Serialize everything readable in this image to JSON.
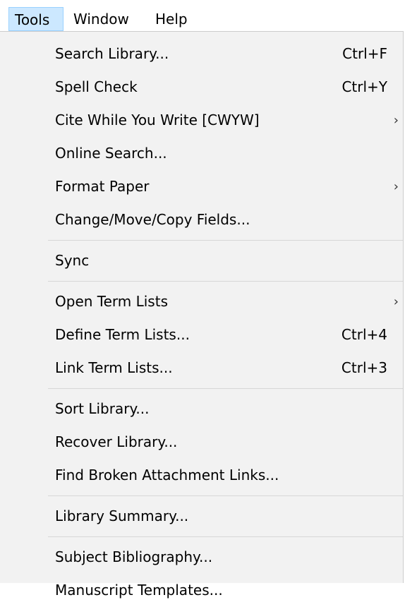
{
  "menubar": {
    "items": [
      {
        "label": "Tools",
        "active": true
      },
      {
        "label": "Window",
        "active": false
      },
      {
        "label": "Help",
        "active": false
      }
    ]
  },
  "menu": {
    "groups": [
      [
        {
          "label": "Search Library...",
          "shortcut": "Ctrl+F",
          "submenu": false
        },
        {
          "label": "Spell Check",
          "shortcut": "Ctrl+Y",
          "submenu": false
        },
        {
          "label": "Cite While You Write [CWYW]",
          "shortcut": "",
          "submenu": true
        },
        {
          "label": "Online Search...",
          "shortcut": "",
          "submenu": false
        },
        {
          "label": "Format Paper",
          "shortcut": "",
          "submenu": true
        },
        {
          "label": "Change/Move/Copy Fields...",
          "shortcut": "",
          "submenu": false
        }
      ],
      [
        {
          "label": "Sync",
          "shortcut": "",
          "submenu": false
        }
      ],
      [
        {
          "label": "Open Term Lists",
          "shortcut": "",
          "submenu": true
        },
        {
          "label": "Define Term Lists...",
          "shortcut": "Ctrl+4",
          "submenu": false
        },
        {
          "label": "Link Term Lists...",
          "shortcut": "Ctrl+3",
          "submenu": false
        }
      ],
      [
        {
          "label": "Sort Library...",
          "shortcut": "",
          "submenu": false
        },
        {
          "label": "Recover Library...",
          "shortcut": "",
          "submenu": false
        },
        {
          "label": "Find Broken Attachment Links...",
          "shortcut": "",
          "submenu": false
        }
      ],
      [
        {
          "label": "Library Summary...",
          "shortcut": "",
          "submenu": false
        }
      ],
      [
        {
          "label": "Subject Bibliography...",
          "shortcut": "",
          "submenu": false
        },
        {
          "label": "Manuscript Templates...",
          "shortcut": "",
          "submenu": false
        }
      ]
    ],
    "submenu_glyph": "›"
  },
  "colors": {
    "active_menubar_bg": "#cce8ff",
    "active_menubar_border": "#99d1ff",
    "menu_bg": "#f2f2f2",
    "separator": "#d7d7d7"
  }
}
